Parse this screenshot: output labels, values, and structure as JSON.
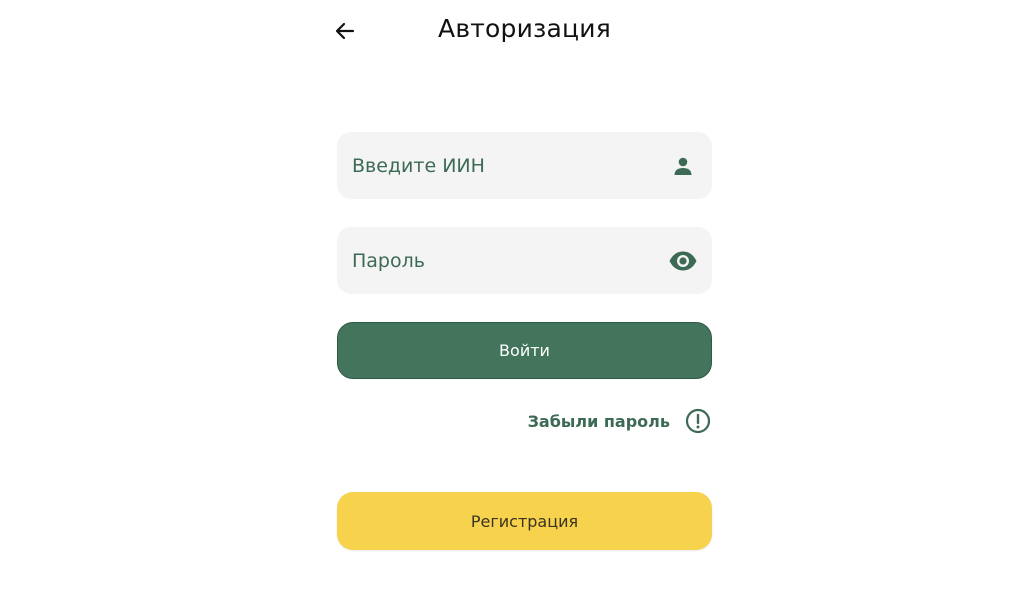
{
  "header": {
    "title": "Авторизация",
    "back_icon": "arrow-left-icon"
  },
  "form": {
    "iin": {
      "placeholder": "Введите ИИН",
      "value": "",
      "icon": "person-icon"
    },
    "password": {
      "placeholder": "Пароль",
      "value": "",
      "icon": "eye-icon"
    },
    "login_label": "Войти",
    "forgot_label": "Забыли пароль",
    "forgot_icon": "exclamation-circle-icon",
    "register_label": "Регистрация"
  },
  "colors": {
    "primary_green": "#43745c",
    "text_green": "#3c6a55",
    "field_bg": "#f4f4f4",
    "accent_yellow": "#f6d24d"
  }
}
